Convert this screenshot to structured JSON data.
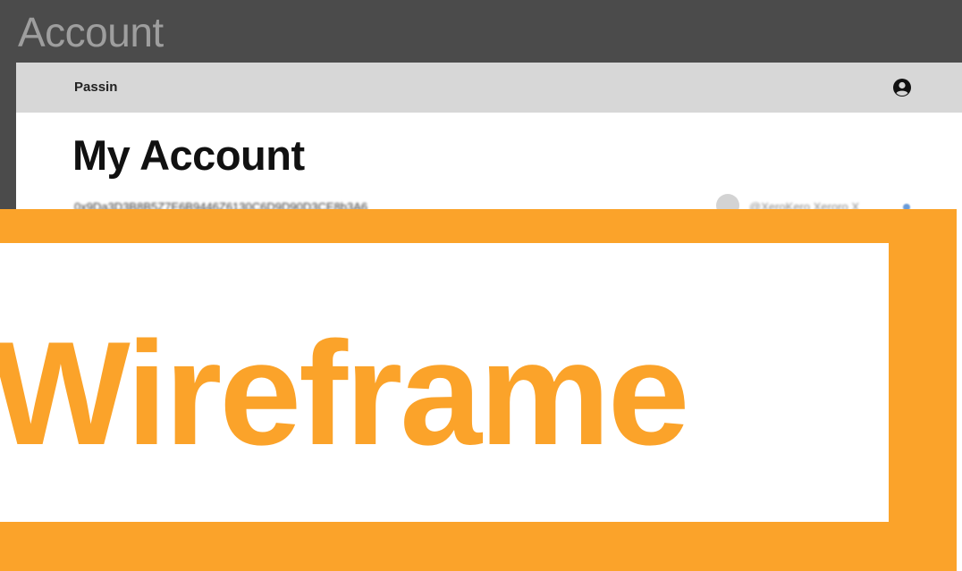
{
  "window": {
    "title": "Account"
  },
  "navbar": {
    "brand": "Passin",
    "account_icon": "user-circle-icon"
  },
  "main": {
    "title": "My Account",
    "wallet_address": "0x9Da3D3B8B5Z7E6B9446Z6130C6D9D90D3CE8b3A6",
    "profile": {
      "handle": "@XeroKero Xeroro X"
    }
  },
  "overlay": {
    "label": "Wireframe",
    "color": "#fba32a"
  }
}
